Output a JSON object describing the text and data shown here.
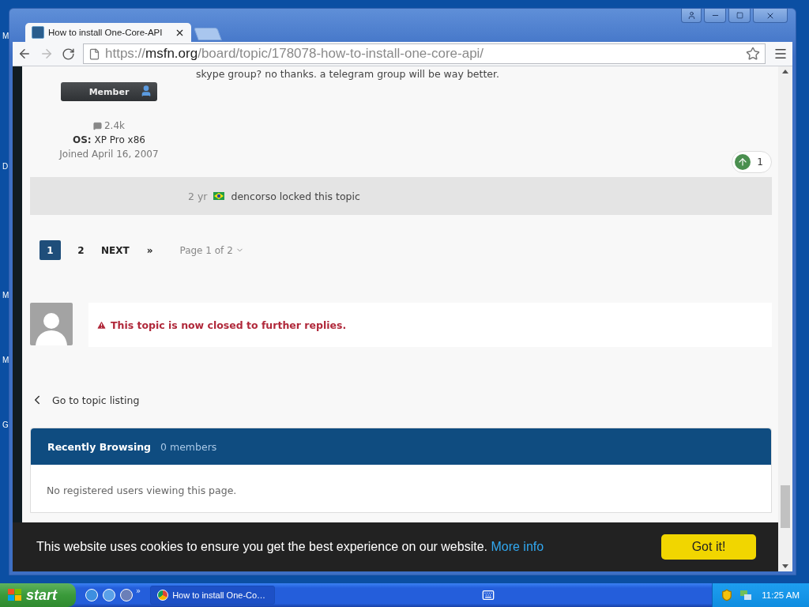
{
  "desktop": {
    "icon_labels": [
      "M",
      "D",
      "M",
      "M",
      "G"
    ]
  },
  "browser": {
    "tabs": [
      {
        "title": "How to install One-Core-API",
        "selected": true
      }
    ],
    "address": {
      "scheme": "https://",
      "host": "msfn.org",
      "path": "/board/topic/178078-how-to-install-one-core-api/"
    }
  },
  "post": {
    "excerpt": "skype group? no thanks. a telegram group will be way better.",
    "author_rank": "Member",
    "post_count": "2.4k",
    "os": "**OS:** XP Pro x86",
    "joined": "Joined April 16, 2007",
    "reactions": "1"
  },
  "event": {
    "time": "2 yr",
    "text": "dencorso locked this topic"
  },
  "pagination": {
    "pages": [
      {
        "label": "1",
        "selected": true
      },
      {
        "label": "2",
        "selected": false
      }
    ],
    "next": "NEXT",
    "last": "»",
    "page_jump": "Page 1 of 2"
  },
  "closed_notice": "This topic is now closed to further replies.",
  "back_link": "Go to topic listing",
  "recently_browsing": {
    "title": "Recently Browsing",
    "count": "0 members",
    "empty": "No registered users viewing this page."
  },
  "cookie": {
    "message": "This website uses cookies to ensure you get the best experience on our website.",
    "link": "More info",
    "button": "Got it!"
  },
  "taskbar": {
    "start": "start",
    "more": "»",
    "windows": [
      {
        "title": "How to install One-Co…",
        "selected": true
      }
    ],
    "clock": "11:25 AM"
  }
}
